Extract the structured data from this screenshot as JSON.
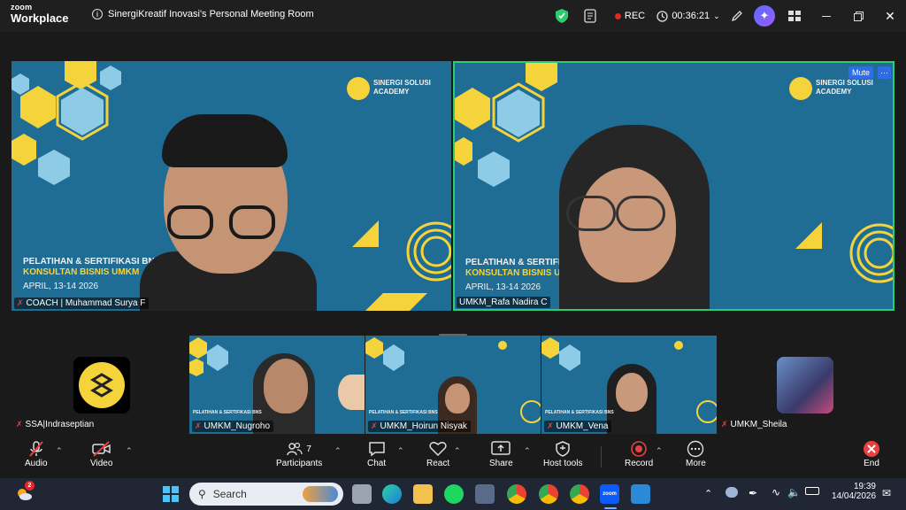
{
  "app": {
    "brand_small": "zoom",
    "brand_large": "Workplace"
  },
  "titlebar": {
    "meeting_title": "SinergiKreatif Inovasi's Personal Meeting Room",
    "rec_label": "REC",
    "timer": "00:36:21"
  },
  "slide": {
    "academy_line1": "SINERGI SOLUSI",
    "academy_line2": "ACADEMY",
    "title1": "PELATIHAN & SERTIFIKASI BNS",
    "title2": "KONSULTAN BISNIS UMKM",
    "date": "APRIL, 13-14  2026",
    "title1_b": "PELATIHAN & SERTIFIKASI",
    "title2_b": "KONSULTAN BISNIS UMK",
    "date_b": "APRIL, 13-14  2026"
  },
  "participants": {
    "main_left": "COACH | Muhammad Surya F",
    "main_right": "UMKM_Rafa Nadira C",
    "mute_label": "Mute",
    "more_label": "···",
    "strip": [
      {
        "name": "SSA|Indraseptian"
      },
      {
        "name": "UMKM_Nugroho"
      },
      {
        "name": "UMKM_Hoirun Nisyak"
      },
      {
        "name": "UMKM_Vena"
      },
      {
        "name": "UMKM_Sheila"
      }
    ]
  },
  "toolbar": {
    "audio": "Audio",
    "video": "Video",
    "participants": "Participants",
    "participants_count": "7",
    "chat": "Chat",
    "react": "React",
    "share": "Share",
    "host_tools": "Host tools",
    "record": "Record",
    "more": "More",
    "end": "End"
  },
  "taskbar": {
    "search_placeholder": "Search",
    "weather_badge": "2",
    "time": "19:39",
    "date": "14/04/2026"
  },
  "colors": {
    "accent_green": "#2ecc71",
    "slide_blue": "#1f6c95",
    "hex_yellow": "#f5d33b",
    "rec_red": "#e02828",
    "end_red": "#e84040"
  }
}
